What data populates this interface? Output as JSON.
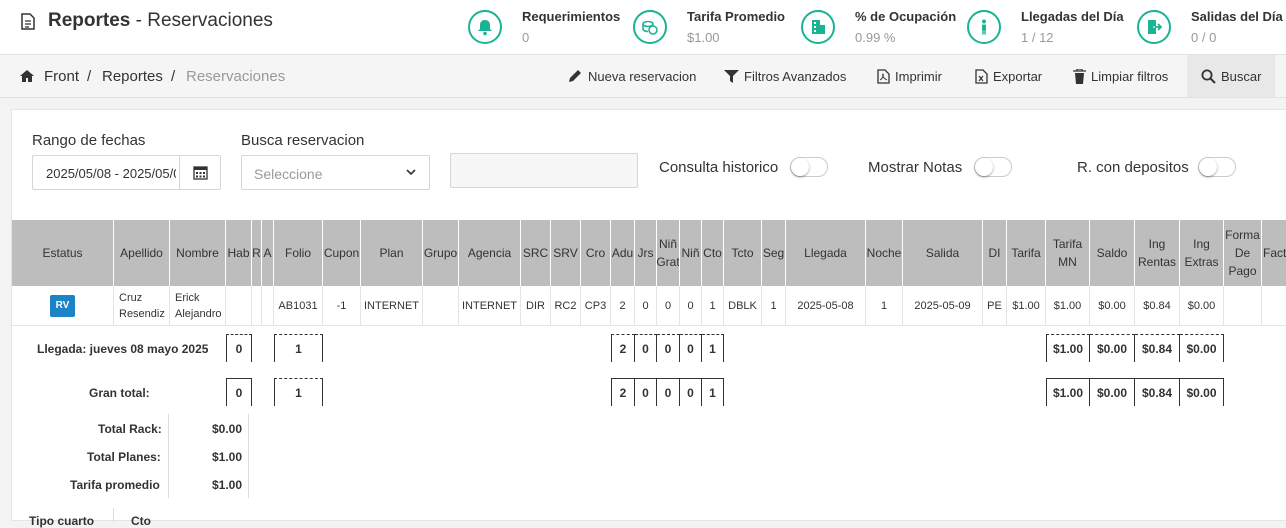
{
  "header": {
    "title_bold": "Reportes",
    "title_rest": " - Reservaciones",
    "stats": [
      {
        "icon": "bell-icon",
        "label": "Requerimientos",
        "value": "0"
      },
      {
        "icon": "coins-icon",
        "label": "Tarifa Promedio",
        "value": "$1.00"
      },
      {
        "icon": "building-icon",
        "label": "% de Ocupación",
        "value": "0.99 %"
      },
      {
        "icon": "person-icon",
        "label": "Llegadas del Día",
        "value": "1 / 12"
      },
      {
        "icon": "exit-door-icon",
        "label": "Salidas del Día",
        "value": "0 / 0"
      }
    ]
  },
  "breadcrumb": [
    "Front",
    "Reportes",
    "Reservaciones"
  ],
  "toolbar": {
    "new": "Nueva reservacion",
    "filters": "Filtros Avanzados",
    "print": "Imprimir",
    "export": "Exportar",
    "clear": "Limpiar filtros",
    "search": "Buscar"
  },
  "filters": {
    "date_label": "Rango de fechas",
    "date_value": "2025/05/08 - 2025/05/08",
    "search_label": "Busca reservacion",
    "search_placeholder": "Seleccione",
    "history_label": "Consulta historico",
    "notes_label": "Mostrar Notas",
    "deposits_label": "R. con depositos"
  },
  "columns": [
    "Estatus",
    "Apellido",
    "Nombre",
    "Hab",
    "R",
    "A",
    "Folio",
    "Cupon",
    "Plan",
    "Grupo",
    "Agencia",
    "SRC",
    "SRV",
    "Cro",
    "Adu",
    "Jrs",
    "Niñ Grat",
    "Niñ",
    "Cto",
    "Tcto",
    "Seg",
    "Llegada",
    "Noche",
    "Salida",
    "DI",
    "Tarifa",
    "Tarifa MN",
    "Saldo",
    "Ing Rentas",
    "Ing Extras",
    "Forma De Pago",
    "Fact"
  ],
  "row": {
    "status": "RV",
    "apellido": "Cruz Resendiz",
    "nombre": "Erick Alejandro",
    "hab": "",
    "r": "",
    "a": "",
    "folio": "AB1031",
    "cupon": "-1",
    "plan": "INTERNET",
    "grupo": "",
    "agencia": "INTERNET",
    "src": "DIR",
    "srv": "RC2",
    "cro": "CP3",
    "adu": "2",
    "jrs": "0",
    "nin_grat": "0",
    "nin": "0",
    "cto": "1",
    "tcto": "DBLK",
    "seg": "1",
    "llegada": "2025-05-08",
    "noche": "1",
    "salida": "2025-05-09",
    "di": "PE",
    "tarifa": "$1.00",
    "tarifa_mn": "$1.00",
    "saldo": "$0.00",
    "ing_rentas": "$0.84",
    "ing_extras": "$0.00"
  },
  "subtotal": {
    "label": "Llegada: jueves 08 mayo 2025",
    "hab": "0",
    "folio": "1",
    "adu": "2",
    "jrs": "0",
    "nin_grat": "0",
    "nin": "0",
    "cto": "1",
    "tarifa_mn": "$1.00",
    "saldo": "$0.00",
    "ing_rentas": "$0.84",
    "ing_extras": "$0.00"
  },
  "grandtotal": {
    "label": "Gran total:",
    "hab": "0",
    "folio": "1",
    "adu": "2",
    "jrs": "0",
    "nin_grat": "0",
    "nin": "0",
    "cto": "1",
    "tarifa_mn": "$1.00",
    "saldo": "$0.00",
    "ing_rentas": "$0.84",
    "ing_extras": "$0.00"
  },
  "totals": [
    {
      "label": "Total Rack:",
      "value": "$0.00"
    },
    {
      "label": "Total Planes:",
      "value": "$1.00"
    },
    {
      "label": "Tarifa promedio",
      "value": "$1.00"
    }
  ],
  "room_table": {
    "col1": "Tipo cuarto",
    "col2": "Cto"
  }
}
